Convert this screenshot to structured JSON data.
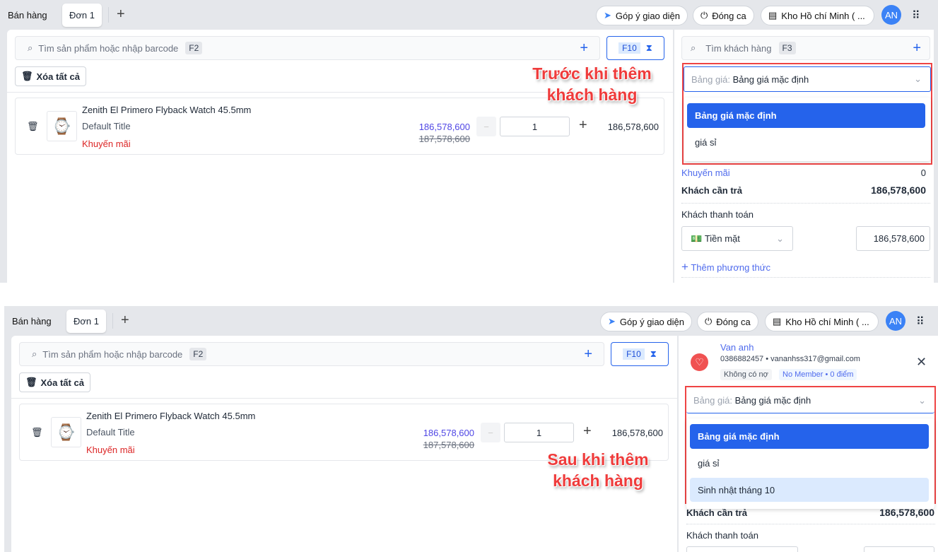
{
  "tabbar": {
    "title": "Bán hàng",
    "tab": "Đơn 1",
    "add": "+",
    "feedback": "Góp ý giao diện",
    "close_shift": "Đóng ca",
    "store": "Kho Hồ chí Minh ( ...",
    "avatar": "AN"
  },
  "product_search": {
    "placeholder": "Tìm sản phẩm hoặc nhập barcode",
    "shortcut": "F2",
    "add": "+",
    "f10": "F10"
  },
  "clear_all": "Xóa tất cả",
  "item": {
    "name": "Zenith El Primero Flyback Watch 45.5mm",
    "variant": "Default Title",
    "promo": "Khuyến mãi",
    "price": "186,578,600",
    "original_price": "187,578,600",
    "minus": "−",
    "qty": "1",
    "plus": "+",
    "total": "186,578,600"
  },
  "customer_search": {
    "placeholder": "Tìm khách hàng",
    "shortcut": "F3",
    "add": "+"
  },
  "price_list": {
    "label": "Bảng giá:",
    "value": "Bảng giá mặc định"
  },
  "options_before": [
    "Bảng giá mặc định",
    "giá sỉ"
  ],
  "options_after": [
    "Bảng giá mặc định",
    "giá sỉ",
    "Sinh nhật tháng 10"
  ],
  "summary": {
    "promo_label": "Khuyến mãi",
    "promo_value": "0",
    "due_label": "Khách cần trả",
    "due_value": "186,578,600",
    "pay_label": "Khách thanh toán",
    "method": "Tiền mặt",
    "amount": "186,578,600",
    "add_method": "Thêm phương thức"
  },
  "customer": {
    "name": "Van anh",
    "contact": "0386882457 • vananhss317@gmail.com",
    "debt": "Không có nợ",
    "member": "No Member • 0 điểm"
  },
  "annotations": {
    "before_1": "Trước khi thêm",
    "before_2": "khách hàng",
    "after_1": "Sau  khi thêm",
    "after_2": "khách hàng"
  },
  "colors": {
    "accent": "#2563eb",
    "highlight": "#ef4444"
  }
}
